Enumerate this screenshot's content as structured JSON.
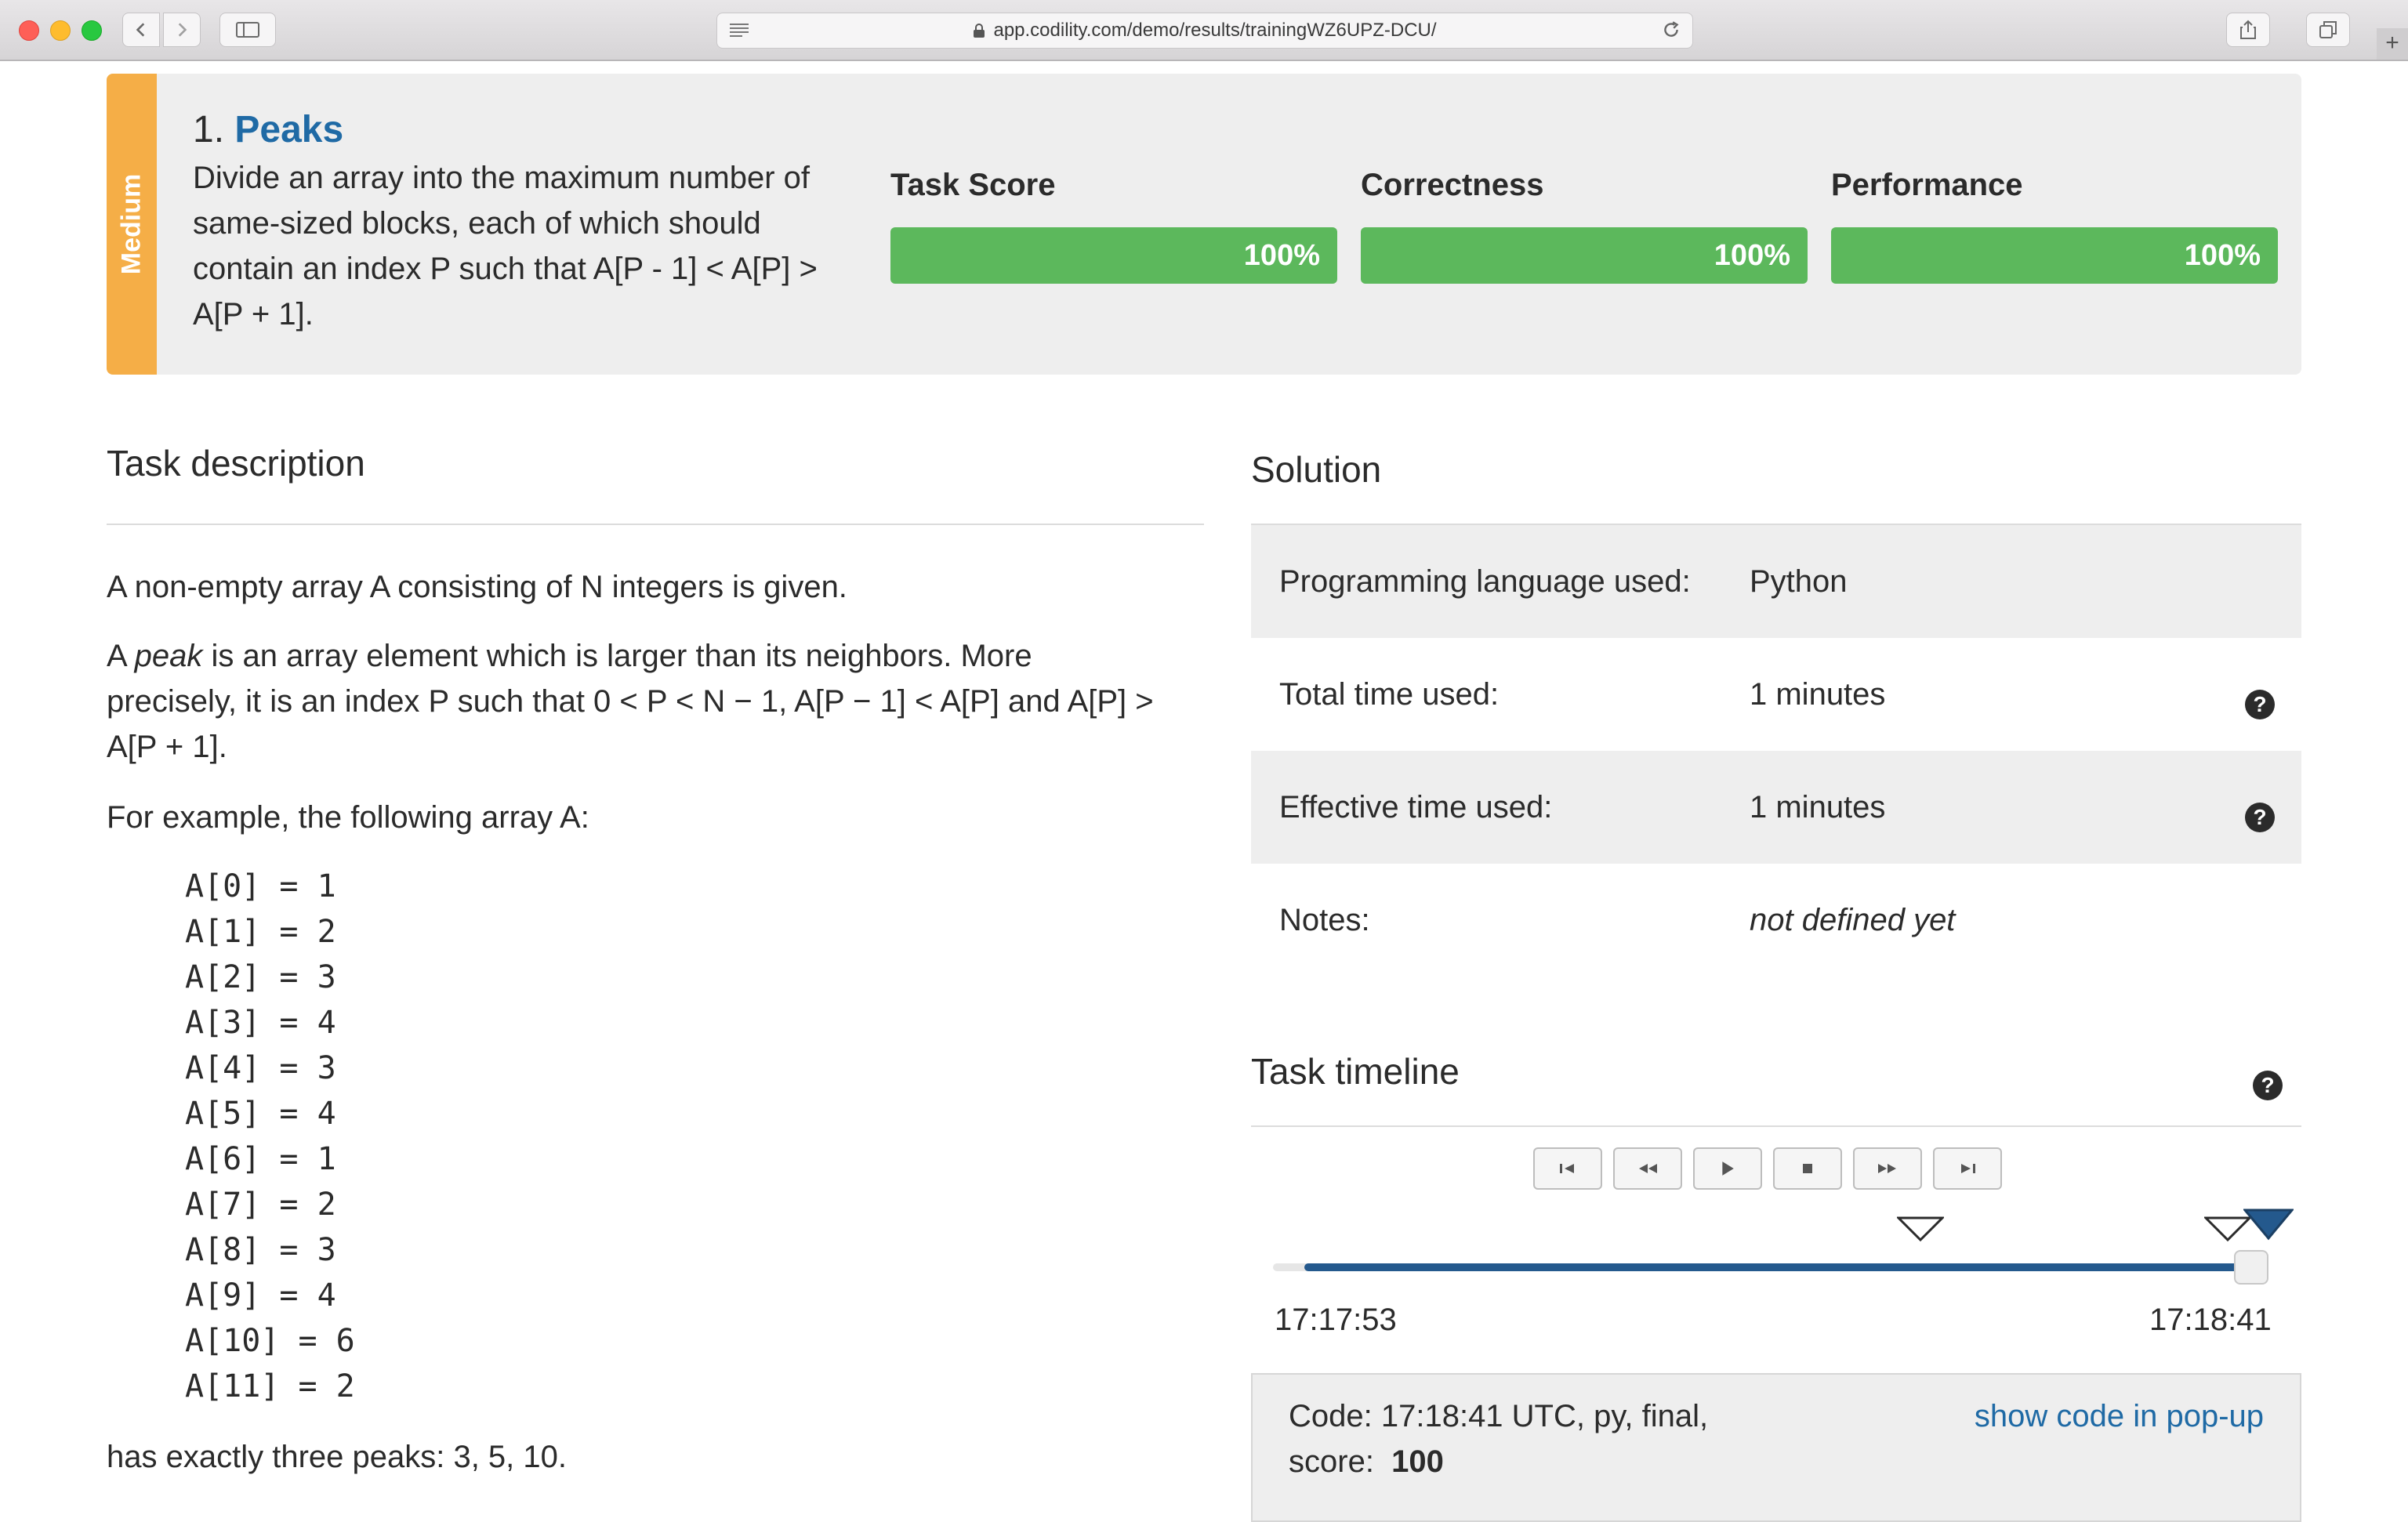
{
  "browser": {
    "url": "app.codility.com/demo/results/trainingWZ6UPZ-DCU/",
    "new_tab": "+"
  },
  "task": {
    "difficulty": "Medium",
    "number": "1.",
    "name": "Peaks",
    "summary": "Divide an array into the maximum number of same-sized blocks, each of which should contain an index P such that A[P - 1] < A[P] > A[P + 1].",
    "scores": [
      {
        "label": "Task Score",
        "value": "100%",
        "fraction": 1.0
      },
      {
        "label": "Correctness",
        "value": "100%",
        "fraction": 1.0
      },
      {
        "label": "Performance",
        "value": "100%",
        "fraction": 1.0
      }
    ],
    "score_color": "#5cb85c",
    "difficulty_color": "#f5ae47"
  },
  "description": {
    "title": "Task description",
    "para1": "A non-empty array A consisting of N integers is given.",
    "para2_prefix": "A ",
    "para2_term": "peak",
    "para2_line1_rest": " is an array element which is larger than its neighbors. More",
    "para2_line2": "precisely, it is an index P such that 0 < P < N − 1,  A[P − 1] < A[P] and A[P] >",
    "para2_line3": "A[P + 1].",
    "para3": "For example, the following array A:",
    "array_lines": [
      "A[0] = 1",
      "A[1] = 2",
      "A[2] = 3",
      "A[3] = 4",
      "A[4] = 3",
      "A[5] = 4",
      "A[6] = 1",
      "A[7] = 2",
      "A[8] = 3",
      "A[9] = 4",
      "A[10] = 6",
      "A[11] = 2"
    ],
    "para4": "has exactly three peaks: 3, 5, 10."
  },
  "solution": {
    "title": "Solution",
    "rows": [
      {
        "label": "Programming language used:",
        "value": "Python"
      },
      {
        "label": "Total time used:",
        "value": "1 minutes"
      },
      {
        "label": "Effective time used:",
        "value": "1 minutes"
      },
      {
        "label": "Notes:",
        "value": "not defined yet"
      }
    ],
    "help_glyph": "?"
  },
  "timeline": {
    "title": "Task timeline",
    "controls": [
      "first-icon",
      "rewind-icon",
      "play-icon",
      "stop-icon",
      "fast-forward-icon",
      "last-icon"
    ],
    "start_time": "17:17:53",
    "end_time": "17:18:41",
    "position": 1.0,
    "accent": "#24598d",
    "code_info_prefix": "Code: 17:18:41 UTC, py, final,",
    "score_label": "score:",
    "score_value": "100",
    "popup_link": "show code in pop-up"
  }
}
